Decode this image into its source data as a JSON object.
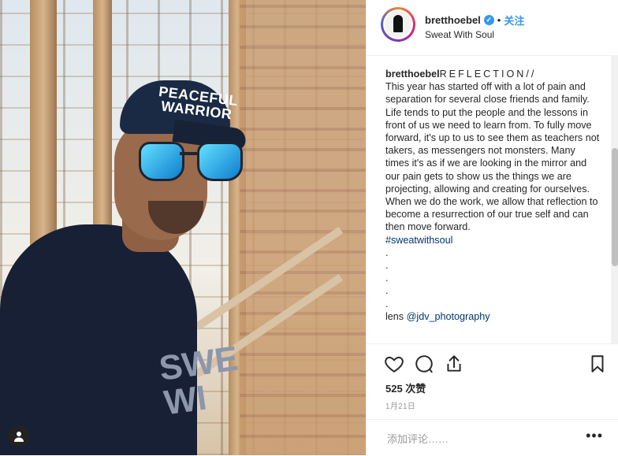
{
  "post": {
    "username": "bretthoebel",
    "verified": true,
    "separator": "•",
    "follow_label": "关注",
    "subtitle": "Sweat With Soul"
  },
  "caption": {
    "username": "bretthoebel",
    "title": "REFLECTION//",
    "body": "This year has started off with a lot of pain and separation for several close friends and family. Life tends to put the people and the lessons in front of us we need to learn from. To fully move forward, it's up to us to see them as teachers not takers, as messengers not monsters. Many times it's as if we are looking in the mirror and our pain gets to show us the things we are projecting, allowing and creating for ourselves. When we do the work, we allow that reflection to become a resurrection of our true self and can then move forward.",
    "hashtag": "#sweatwithsoul",
    "dots": ".\n.\n.\n.\n.",
    "credit_prefix": "lens ",
    "credit_handle": "@jdv_photography"
  },
  "photo": {
    "cap_text": "PEACEFUL\nWARRIOR",
    "shirt_text": "SWE\nWI"
  },
  "actions": {
    "like_icon": "heart-icon",
    "comment_icon": "comment-icon",
    "share_icon": "share-icon",
    "save_icon": "bookmark-icon"
  },
  "stats": {
    "likes": "525 次赞",
    "date": "1月21日"
  },
  "comment": {
    "placeholder": "添加评论……",
    "more_label": "•••"
  },
  "colors": {
    "accent": "#3897f0",
    "hashtag": "#003569"
  }
}
